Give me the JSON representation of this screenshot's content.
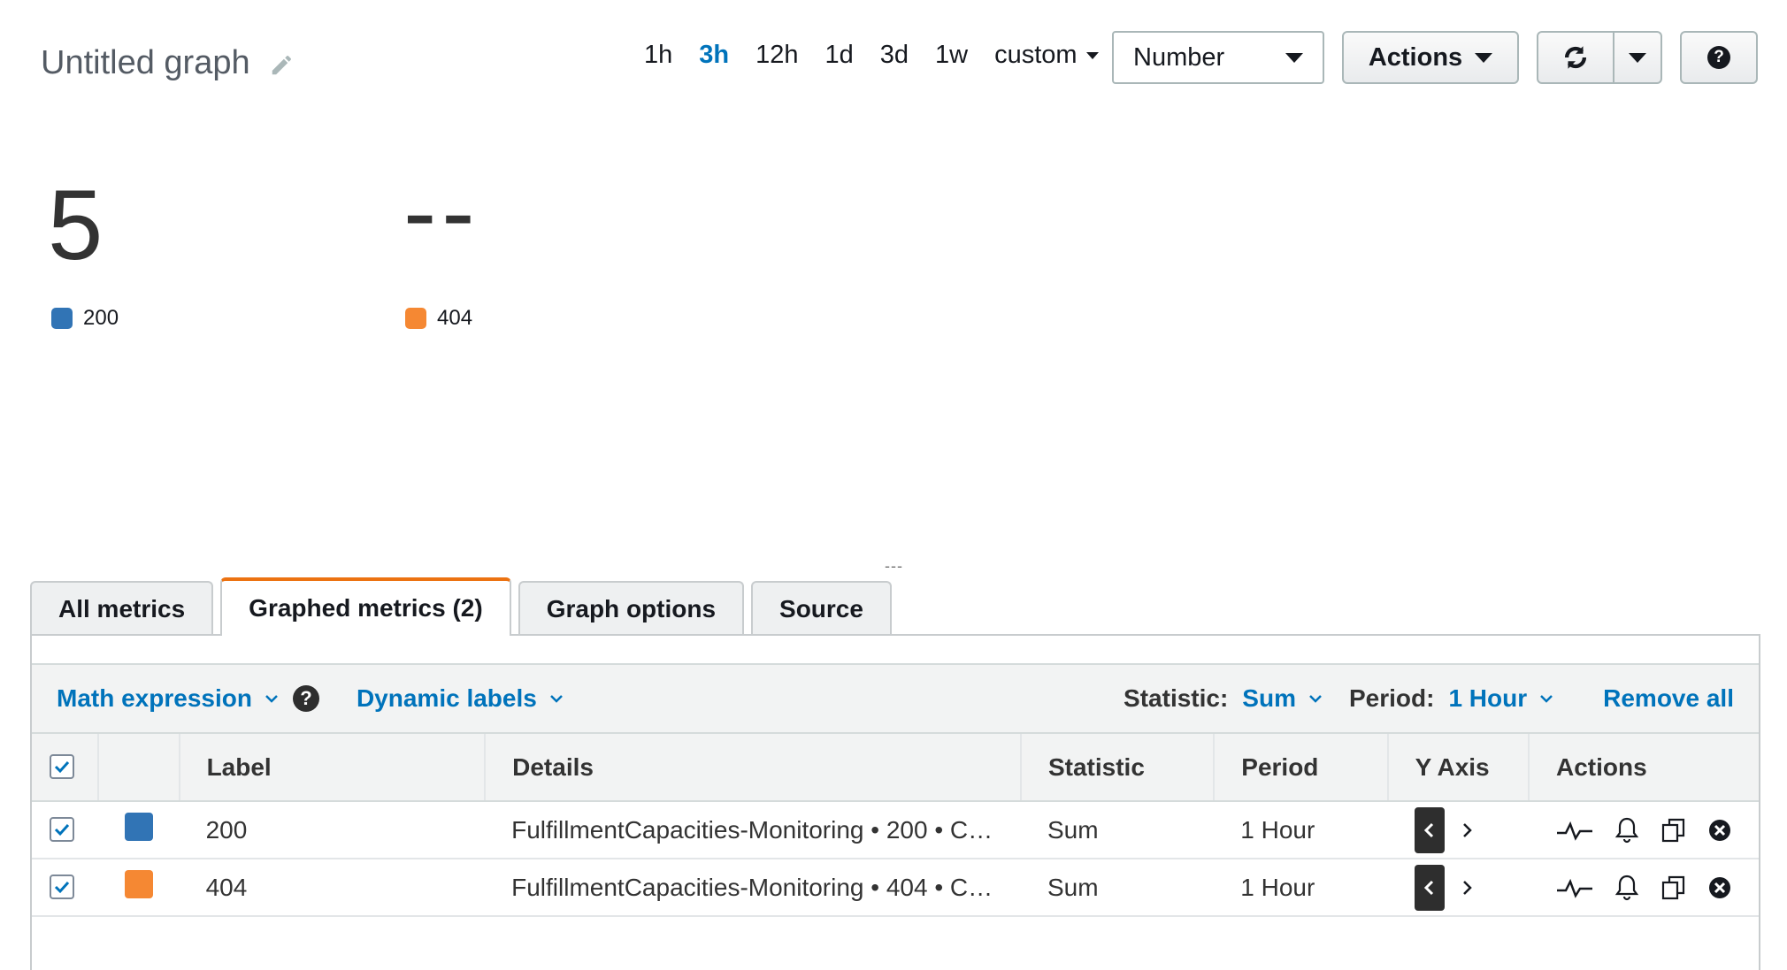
{
  "header": {
    "title": "Untitled graph",
    "time_ranges": [
      "1h",
      "3h",
      "12h",
      "1d",
      "3d",
      "1w"
    ],
    "active_range": "3h",
    "custom_label": "custom",
    "view_select": "Number",
    "actions_label": "Actions"
  },
  "widgets": [
    {
      "value": "5",
      "legend": "200",
      "color": "#3174b5"
    },
    {
      "value": "--",
      "legend": "404",
      "color": "#f58833"
    }
  ],
  "resize_handle": "---",
  "tabs": [
    {
      "label": "All metrics",
      "active": false
    },
    {
      "label": "Graphed metrics (2)",
      "active": true
    },
    {
      "label": "Graph options",
      "active": false
    },
    {
      "label": "Source",
      "active": false
    }
  ],
  "toolbar": {
    "math_expression": "Math expression",
    "dynamic_labels": "Dynamic labels",
    "statistic_label": "Statistic:",
    "statistic_value": "Sum",
    "period_label": "Period:",
    "period_value": "1 Hour",
    "remove_all": "Remove all"
  },
  "table": {
    "headers": [
      "Label",
      "Details",
      "Statistic",
      "Period",
      "Y Axis",
      "Actions"
    ],
    "rows": [
      {
        "label": "200",
        "details": "FulfillmentCapacities-Monitoring • 200 • C…",
        "statistic": "Sum",
        "period": "1 Hour",
        "color": "#3174b5"
      },
      {
        "label": "404",
        "details": "FulfillmentCapacities-Monitoring • 404 • C…",
        "statistic": "Sum",
        "period": "1 Hour",
        "color": "#f58833"
      }
    ]
  }
}
